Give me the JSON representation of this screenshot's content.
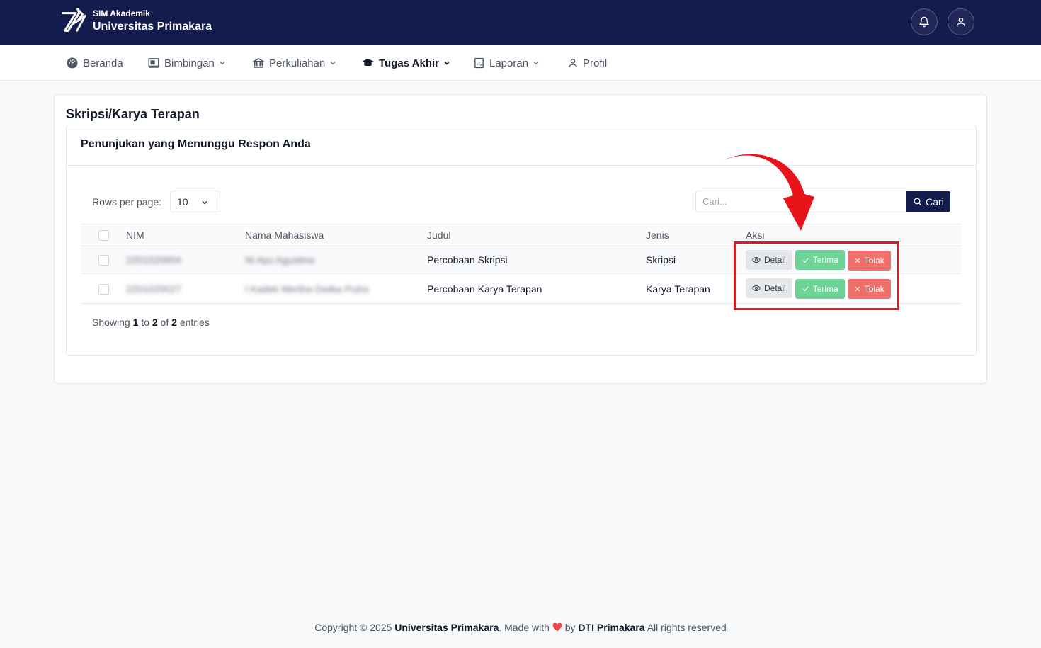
{
  "header": {
    "subtitle": "SIM Akademik",
    "title": "Universitas Primakara",
    "icons": [
      "bell-icon",
      "user-icon"
    ]
  },
  "nav": {
    "items": [
      {
        "label": "Beranda",
        "icon": "dashboard-icon",
        "dropdown": false
      },
      {
        "label": "Bimbingan",
        "icon": "board-icon",
        "dropdown": true
      },
      {
        "label": "Perkuliahan",
        "icon": "building-icon",
        "dropdown": true
      },
      {
        "label": "Tugas Akhir",
        "icon": "graduation-cap-icon",
        "dropdown": true,
        "active": true
      },
      {
        "label": "Laporan",
        "icon": "report-icon",
        "dropdown": true
      },
      {
        "label": "Profil",
        "icon": "user-icon",
        "dropdown": false
      }
    ]
  },
  "page": {
    "title": "Skripsi/Karya Terapan",
    "card_title": "Penunjukan yang Menunggu Respon Anda"
  },
  "controls": {
    "rows_label": "Rows per page:",
    "rows_value": "10",
    "search_placeholder": "Cari...",
    "search_button": "Cari"
  },
  "table": {
    "headers": [
      "NIM",
      "Nama Mahasiswa",
      "Judul",
      "Jenis",
      "Aksi"
    ],
    "rows": [
      {
        "nim": "2201020004",
        "nama": "Ni Ayu Agustina",
        "judul": "Percobaan Skripsi",
        "jenis": "Skripsi"
      },
      {
        "nim": "2201020027",
        "nama": "I Kadek Mertha Dwika Putra",
        "judul": "Percobaan Karya Terapan",
        "jenis": "Karya Terapan"
      }
    ],
    "actions": {
      "detail": "Detail",
      "terima": "Terima",
      "tolak": "Tolak"
    }
  },
  "pagination": {
    "showing_prefix": "Showing",
    "from": "1",
    "to_word": "to",
    "to": "2",
    "of_word": "of",
    "total": "2",
    "suffix": "entries"
  },
  "footer": {
    "copyright": "Copyright © 2025",
    "org": "Universitas Primakara",
    "made_with": ". Made with",
    "by": "by",
    "team": "DTI Primakara",
    "rights": "All rights reserved"
  },
  "colors": {
    "header_bg": "#141b4d",
    "terima": "#6dd397",
    "tolak": "#ef6f6a",
    "highlight": "#e0191f",
    "heart": "#ef4444"
  }
}
